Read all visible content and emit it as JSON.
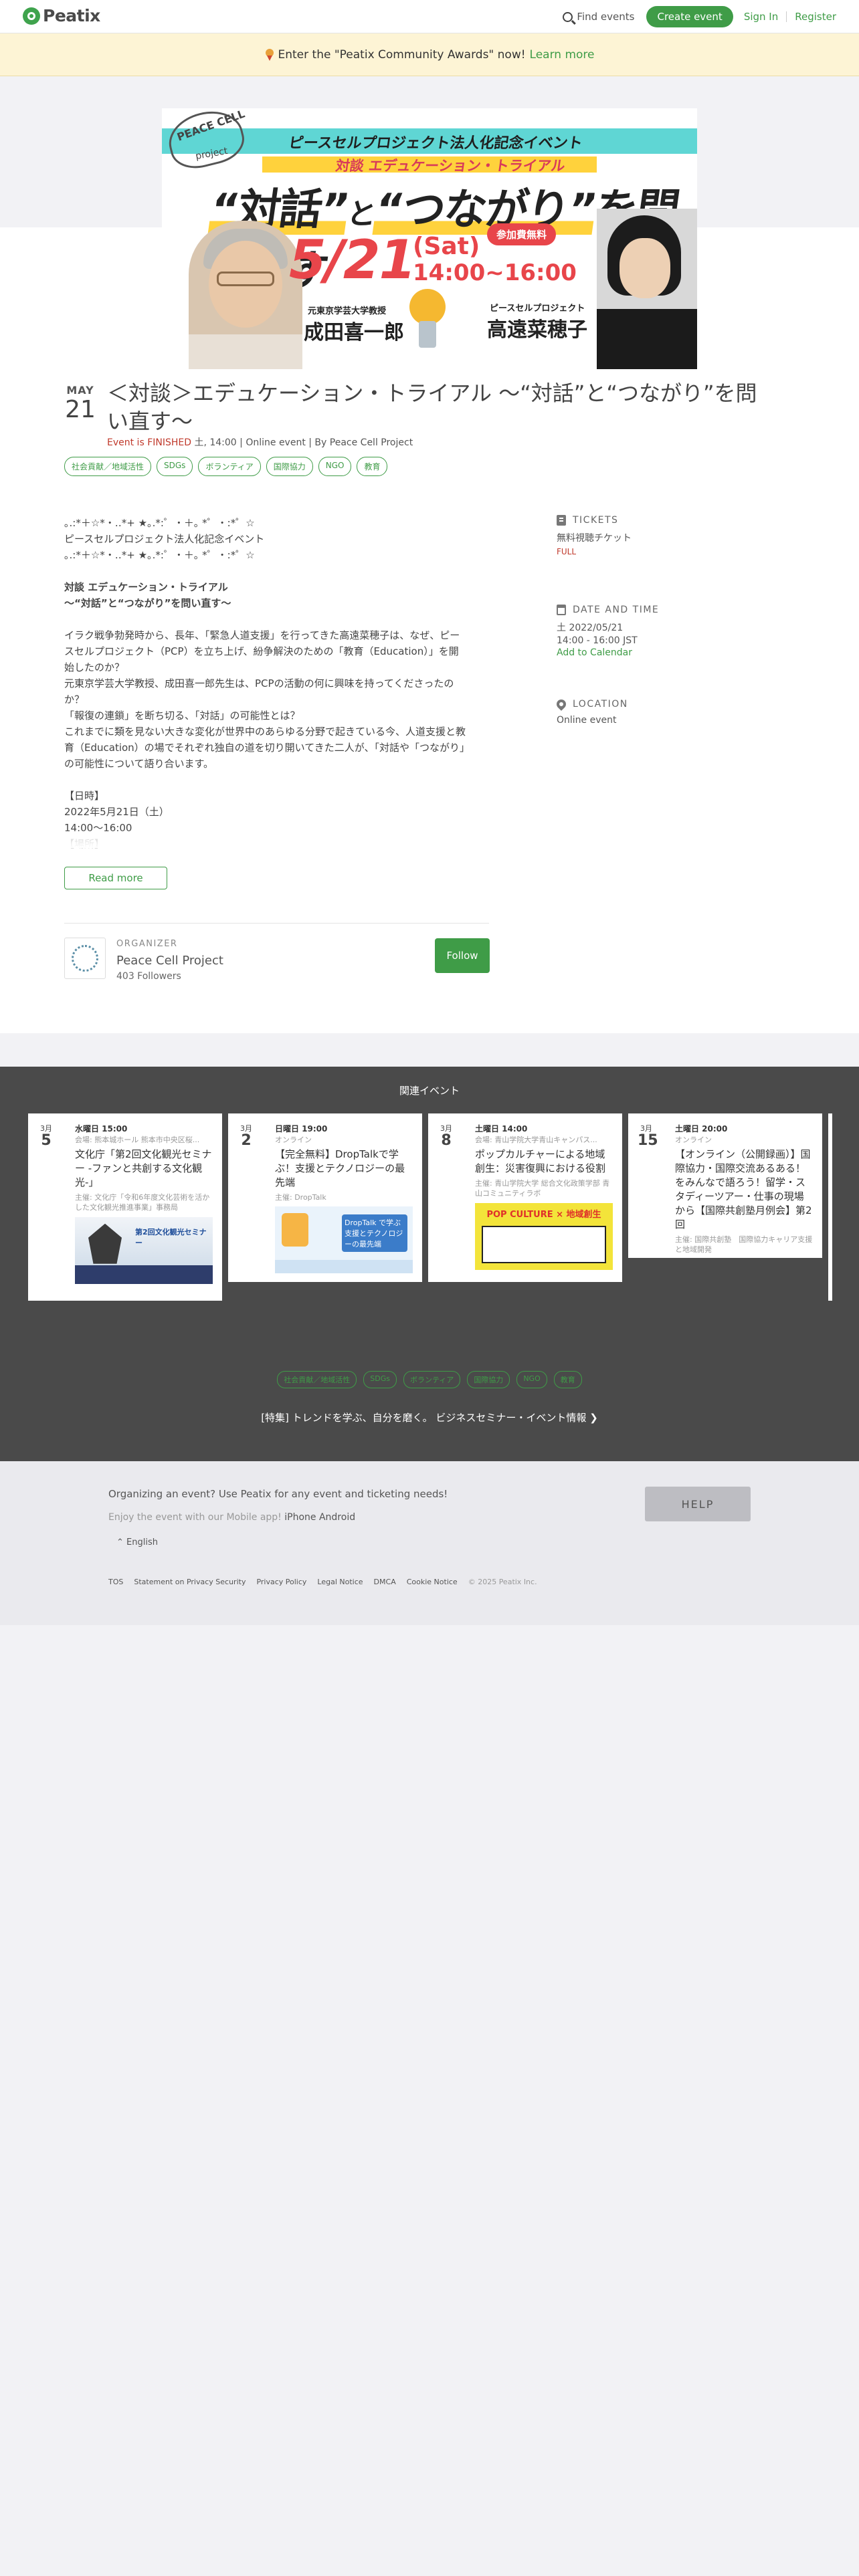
{
  "header": {
    "logo": "Peatix",
    "find_events": "Find events",
    "create_event": "Create event",
    "sign_in": "Sign In",
    "register": "Register"
  },
  "banner": {
    "text": "Enter the \"Peatix Community Awards\" now!",
    "link": "Learn more"
  },
  "hero": {
    "org_logo_text": "PEACE CELL",
    "org_logo_sub": "project",
    "top_line": "ピースセルプロジェクト法人化記念イベント",
    "sub_line": "対談 エデュケーション・トライアル",
    "main_a": "“対話”",
    "main_b": "と",
    "main_c": "“つながり”",
    "main_d": "を問い直す",
    "date": "5/21",
    "day": "(Sat)",
    "time": "14:00~16:00",
    "badge": "参加費無料",
    "speaker1_title": "元東京学芸大学教授",
    "speaker1": "成田喜一郎",
    "speaker2_title": "ピースセルプロジェクト",
    "speaker2": "高遠菜穂子"
  },
  "event": {
    "month": "MAY",
    "day": "21",
    "title": "＜対談＞エデュケーション・トライアル 〜“対話”と“つながり”を問い直す〜",
    "status": "Event is FINISHED",
    "meta": "土, 14:00 | Online event | By Peace Cell Project",
    "tags": [
      "社会貢献／地域活性",
      "SDGs",
      "ボランティア",
      "国際協力",
      "NGO",
      "教育"
    ]
  },
  "description": [
    "｡.:*＋☆*・‥*+ ★｡.*:゜・＋｡ *゜・:*゜☆",
    "ピースセルプロジェクト法人化記念イベント",
    "｡.:*＋☆*・‥*+ ★｡.*:゜・＋｡ *゜・:*゜☆",
    "",
    "対談 エデュケーション・トライアル",
    "〜“対話”と“つながり”を問い直す〜",
    "",
    "イラク戦争勃発時から、長年、「緊急人道支援」を行ってきた高遠菜穂子は、なぜ、ピー",
    "スセルプロジェクト（PCP）を立ち上げ、紛争解決のための「教育（Education）」を開",
    "始したのか？",
    "元東京学芸大学教授、成田喜一郎先生は、PCPの活動の何に興味を持ってくださったの",
    "か？",
    "「報復の連鎖」を断ち切る、「対話」の可能性とは？",
    "これまでに類を見ない大きな変化が世界中のあらゆる分野で起きている今、人道支援と教",
    "育（Education）の場でそれぞれ独自の道を切り開いてきた二人が、「対話や「つながり」",
    "の可能性について語り合います。",
    "",
    "【日時】",
    "2022年5月21日（土）",
    "14:00〜16:00",
    "【場所】"
  ],
  "read_more": "Read more",
  "organizer": {
    "label": "ORGANIZER",
    "name": "Peace Cell Project",
    "followers": "403 Followers",
    "follow": "Follow"
  },
  "sidebar": {
    "tickets_label": "TICKETS",
    "ticket_name": "無料視聴チケット",
    "ticket_status": "FULL",
    "datetime_label": "DATE AND TIME",
    "date": "土 2022/05/21",
    "time": "14:00 - 16:00 JST",
    "add_calendar": "Add to Calendar",
    "location_label": "LOCATION",
    "location": "Online event"
  },
  "related": {
    "title": "関連イベント",
    "cards": [
      {
        "month": "3月",
        "day": "5",
        "time": "水曜日 15:00",
        "venue": "会場: 熊本城ホール 熊本市中央区桜...",
        "title": "文化庁「第2回文化観光セミナー -ファンと共創する文化観光-」",
        "host": "主催: 文化庁「令和6年度文化芸術を活かした文化観光推進事業」事務局",
        "img_text": "第2回文化観光セミナー"
      },
      {
        "month": "3月",
        "day": "2",
        "time": "日曜日 19:00",
        "venue": "オンライン",
        "title": "【完全無料】DropTalkで学ぶ！支援とテクノロジーの最先端",
        "host": "主催: DropTalk",
        "img_text": "DropTalk で学ぶ 支援とテクノロジーの最先端"
      },
      {
        "month": "3月",
        "day": "8",
        "time": "土曜日 14:00",
        "venue": "会場: 青山学院大学青山キャンパス...",
        "title": "ポップカルチャーによる地域創生：災害復興における役割",
        "host": "主催: 青山学院大学 総合文化政策学部 青山コミュニティラボ",
        "img_text": "POP CULTURE × 地域創生"
      },
      {
        "month": "3月",
        "day": "15",
        "time": "土曜日 20:00",
        "venue": "オンライン",
        "title": "【オンライン（公開録画）】国際協力・国際交流あるある！をみんなで語ろう！留学・スタディーツアー・仕事の現場から【国際共創塾月例会】第2回",
        "host": "主催: 国際共創塾　国際協力キャリア支援と地域開発",
        "img_text": ""
      }
    ],
    "tags": [
      "社会貢献／地域活性",
      "SDGs",
      "ボランティア",
      "国際協力",
      "NGO",
      "教育"
    ],
    "feature": "[特集] トレンドを学ぶ、自分を磨く。 ビジネスセミナー・イベント情報"
  },
  "footer": {
    "line1": "Organizing an event? Use Peatix for any event and ticketing needs!",
    "line2": "Enjoy the event with our Mobile app!",
    "iphone": "iPhone",
    "android": "Android",
    "lang": "English",
    "help": "HELP",
    "links": [
      "TOS",
      "Statement on Privacy Security",
      "Privacy Policy",
      "Legal Notice",
      "DMCA",
      "Cookie Notice"
    ],
    "copyright": "© 2025 Peatix Inc."
  }
}
